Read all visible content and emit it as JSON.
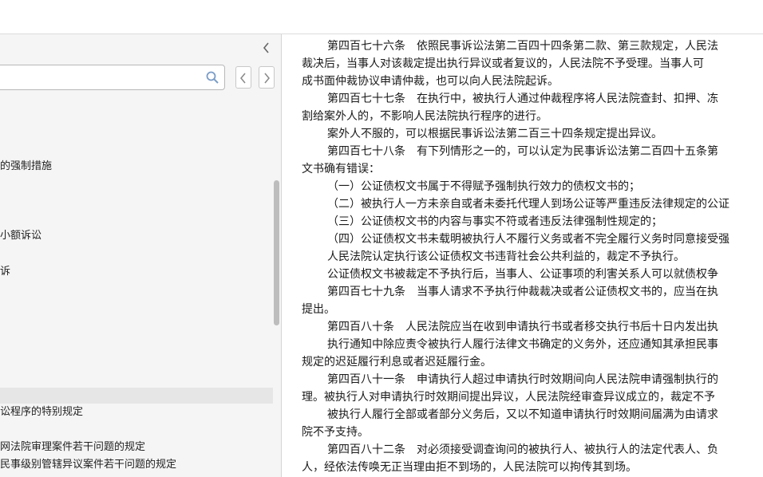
{
  "sidebar": {
    "search": {
      "value": "",
      "placeholder": ""
    },
    "toc_items": [
      "的强制措施",
      "小额诉讼",
      "诉",
      "讼程序的特别规定",
      "网法院审理案件若干问题的规定",
      "民事级别管辖异议案件若干问题的规定"
    ]
  },
  "document": {
    "lines": [
      "第四百七十六条　依照民事诉讼法第二百四十四条第二款、第三款规定，人民法",
      "裁决后，当事人对该裁定提出执行异议或者复议的，人民法院不予受理。当事人可",
      "成书面仲裁协议申请仲裁，也可以向人民法院起诉。",
      "第四百七十七条　在执行中，被执行人通过仲裁程序将人民法院查封、扣押、冻",
      "割给案外人的，不影响人民法院执行程序的进行。",
      "案外人不服的，可以根据民事诉讼法第二百三十四条规定提出异议。",
      "第四百七十八条　有下列情形之一的，可以认定为民事诉讼法第二百四十五条第",
      "文书确有错误：",
      "（一）公证债权文书属于不得赋予强制执行效力的债权文书的；",
      "（二）被执行人一方未亲自或者未委托代理人到场公证等严重违反法律规定的公证",
      "（三）公证债权文书的内容与事实不符或者违反法律强制性规定的；",
      "（四）公证债权文书未载明被执行人不履行义务或者不完全履行义务时同意接受强",
      "人民法院认定执行该公证债权文书违背社会公共利益的，裁定不予执行。",
      "公证债权文书被裁定不予执行后，当事人、公证事项的利害关系人可以就债权争",
      "第四百七十九条　当事人请求不予执行仲裁裁决或者公证债权文书的，应当在执",
      "提出。",
      "第四百八十条　人民法院应当在收到申请执行书或者移交执行书后十日内发出执",
      "执行通知中除应责令被执行人履行法律文书确定的义务外，还应通知其承担民事",
      "规定的迟延履行利息或者迟延履行金。",
      "第四百八十一条　申请执行人超过申请执行时效期间向人民法院申请强制执行的",
      "理。被执行人对申请执行时效期间提出异议，人民法院经审查异议成立的，裁定不予",
      "被执行人履行全部或者部分义务后，又以不知道申请执行时效期间届满为由请求",
      "院不予支持。",
      "第四百八十二条　对必须接受调查询问的被执行人、被执行人的法定代表人、负",
      "人，经依法传唤无正当理由拒不到场的，人民法院可以拘传其到场。"
    ]
  }
}
